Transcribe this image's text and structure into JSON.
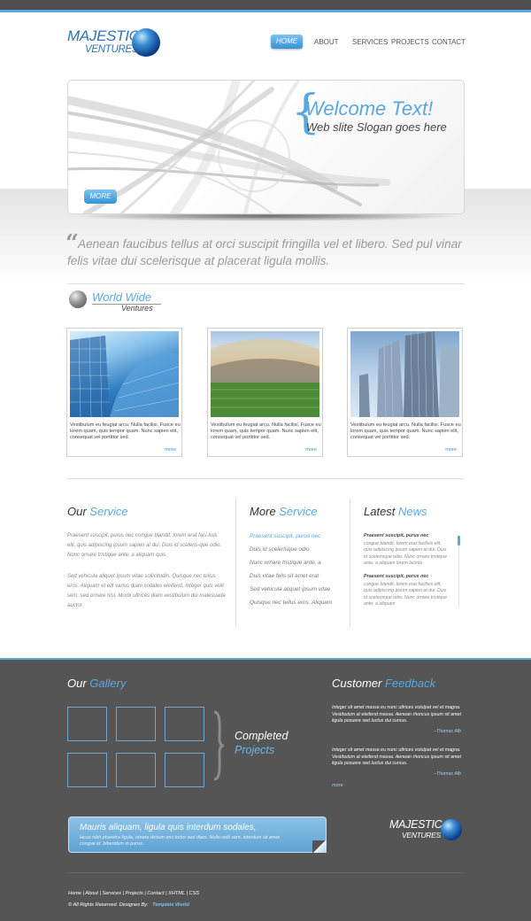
{
  "brand": {
    "line1": "Majestic",
    "line2": "Ventures"
  },
  "nav": {
    "items": [
      {
        "label": "Home"
      },
      {
        "label": "About"
      },
      {
        "label": "Services"
      },
      {
        "label": "Projects"
      },
      {
        "label": "Contact"
      }
    ]
  },
  "hero": {
    "title": "Welcome Text!",
    "slogan": "Web slite Slogan goes here",
    "button": "More"
  },
  "quote": {
    "mark": "“",
    "text": "Aenean faucibus tellus at orci suscipit fringilla vel et libero. Sed pul vinar felis vitae dui scelerisque at placerat ligula mollis."
  },
  "worldwide": {
    "line1": "World Wide",
    "line2": "Ventures"
  },
  "cards": [
    {
      "text": "Vestibulum eu feugiat arcu. Nulla facilisi. Fusce eu lorem quam, quis tempor quam. Nunc sapien elit, consequat vel porttitor sed.",
      "more": "more"
    },
    {
      "text": "Vestibulum eu feugiat arcu. Nulla facilisi. Fusce eu lorem quam, quis tempor quam. Nunc sapien elit, consequat vel porttitor sed.",
      "more": "more"
    },
    {
      "text": "Vestibulum eu feugiat arcu. Nulla facilisi. Fusce eu lorem quam, quis tempor quam. Nunc sapien elit, consequat vel porttitor sed.",
      "more": "more"
    }
  ],
  "our_service": {
    "title_a": "Our",
    "title_b": "Service",
    "p1": "Praesent suscipit, purus nec congue blandit, lorem erat faci-lisis elit, quis adipiscing ipsum sapien at dui. Duis id sceleris-que odio. Nunc ornare tristique ante, a aliquam quis.",
    "p2": "Sed vehicula aliquet ipsum vitae sollicitudin. Quisque nec tellus eros. Aliquam et elit varius diam sodales eleifend. Integer quis velit sem, sed ornare nisi. Morbi ultrices diam vestibulum dui malesuada auctor."
  },
  "more_service": {
    "title_a": "More",
    "title_b": "Service",
    "items": [
      "Praesent suscipit, purus nec",
      "Duis id scelerisque odio.",
      "Nunc ornare tristique ante, a",
      "Duis vitae felis sit amet erat",
      "Sed vehicula aliquet ipsum vitae",
      "Quisque nec tellus eros. Aliquam"
    ]
  },
  "news": {
    "title_a": "Latest",
    "title_b": "News",
    "items": [
      {
        "title": "Praesent suscipit, purus nec",
        "body": "congue blandit, lorem erat facilisis elit, quis adipiscing ipsum sapien at dui. Duis id scelerisque odio. Nunc ornare tristique ante, a aliquam lorem lacinia"
      },
      {
        "title": "Praesent suscipit, purus nec",
        "body": "congue blandit, lorem erat facilisis elit, quis adipiscing ipsum sapien at dui. Duis id scelerisque odio. Nunc ornare tristique ante, a aliquam"
      }
    ]
  },
  "gallery": {
    "title_a": "Our",
    "title_b": "Gallery",
    "completed_a": "Completed",
    "completed_b": "Projects"
  },
  "feedback": {
    "title_a": "Customer",
    "title_b": "Feedback",
    "items": [
      {
        "text": "Integer sit amet massa eu nunc ultrices volutpat vel et magna. Vestibulum at eleifend massa. Aenean rhoncus ipsum sit amet ligula posuere sed luctus dui cursus.",
        "author": "-Thomas Alb"
      },
      {
        "text": "Integer sit amet massa eu nunc ultrices volutpat vel et magna. Vestibulum at eleifend massa. Aenean rhoncus ipsum sit amet ligula posuere sed luctus dui cursus.",
        "author": "-Thomas Alb"
      }
    ],
    "more": "more"
  },
  "note": {
    "title": "Mauris aliquam, ligula quis interdum sodales,",
    "body": "lacus nibh pharetra ligula, ornare dictum orci tortor sed diam. Nulla velit sem, interdum sit amet congue id, bibendum in purus."
  },
  "footer": {
    "links": [
      "Home",
      "About",
      "Services",
      "Projects",
      "Contact",
      "XHTML",
      "CSS"
    ],
    "copyright": "© All Rights Reserved. Designes By:",
    "designer": "Template World"
  },
  "colors": {
    "accent": "#58a8df",
    "footer_bg": "#555555",
    "topbar": "#4e4e4e"
  }
}
